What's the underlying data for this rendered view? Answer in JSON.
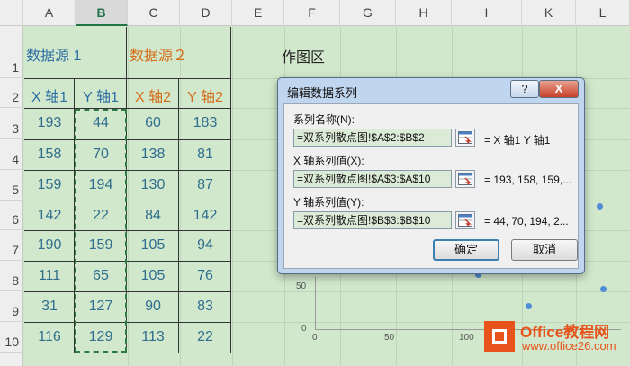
{
  "columns": [
    "A",
    "B",
    "C",
    "D",
    "E",
    "F",
    "G",
    "H",
    "I",
    "K",
    "L"
  ],
  "selected_column": "B",
  "rows": [
    "1",
    "2",
    "3",
    "4",
    "5",
    "6",
    "7",
    "8",
    "9",
    "10"
  ],
  "sheet": {
    "header_source1": "数据源 1",
    "header_source2": "数据源２",
    "col_labels": [
      "X 轴1",
      "Y 轴1",
      "X 轴2",
      "Y 轴2"
    ],
    "data": [
      [
        "193",
        "44",
        "60",
        "183"
      ],
      [
        "158",
        "70",
        "138",
        "81"
      ],
      [
        "159",
        "194",
        "130",
        "87"
      ],
      [
        "142",
        "22",
        "84",
        "142"
      ],
      [
        "190",
        "159",
        "105",
        "94"
      ],
      [
        "111",
        "65",
        "105",
        "76"
      ],
      [
        "31",
        "127",
        "90",
        "83"
      ],
      [
        "116",
        "129",
        "113",
        "22"
      ]
    ],
    "chart_area_title": "作图区"
  },
  "chart": {
    "y_ticks": [
      "50",
      "0"
    ],
    "x_ticks": [
      "0",
      "50",
      "100"
    ]
  },
  "dialog": {
    "title": "编辑数据系列",
    "help_label": "?",
    "close_label": "X",
    "series_name_label": "系列名称(N):",
    "series_name_value": "=双系列散点图!$A$2:$B$2",
    "series_name_preview": "=  X 轴1  Y 轴1",
    "x_values_label": "X 轴系列值(X):",
    "x_values_value": "=双系列散点图!$A$3:$A$10",
    "x_values_preview": "= 193, 158, 159,...",
    "y_values_label": "Y 轴系列值(Y):",
    "y_values_value": "=双系列散点图!$B$3:$B$10",
    "y_values_preview": "= 44, 70, 194, 2...",
    "ok_label": "确定",
    "cancel_label": "取消"
  },
  "watermark": {
    "name": "Office教程网",
    "url": "www.office26.com"
  }
}
